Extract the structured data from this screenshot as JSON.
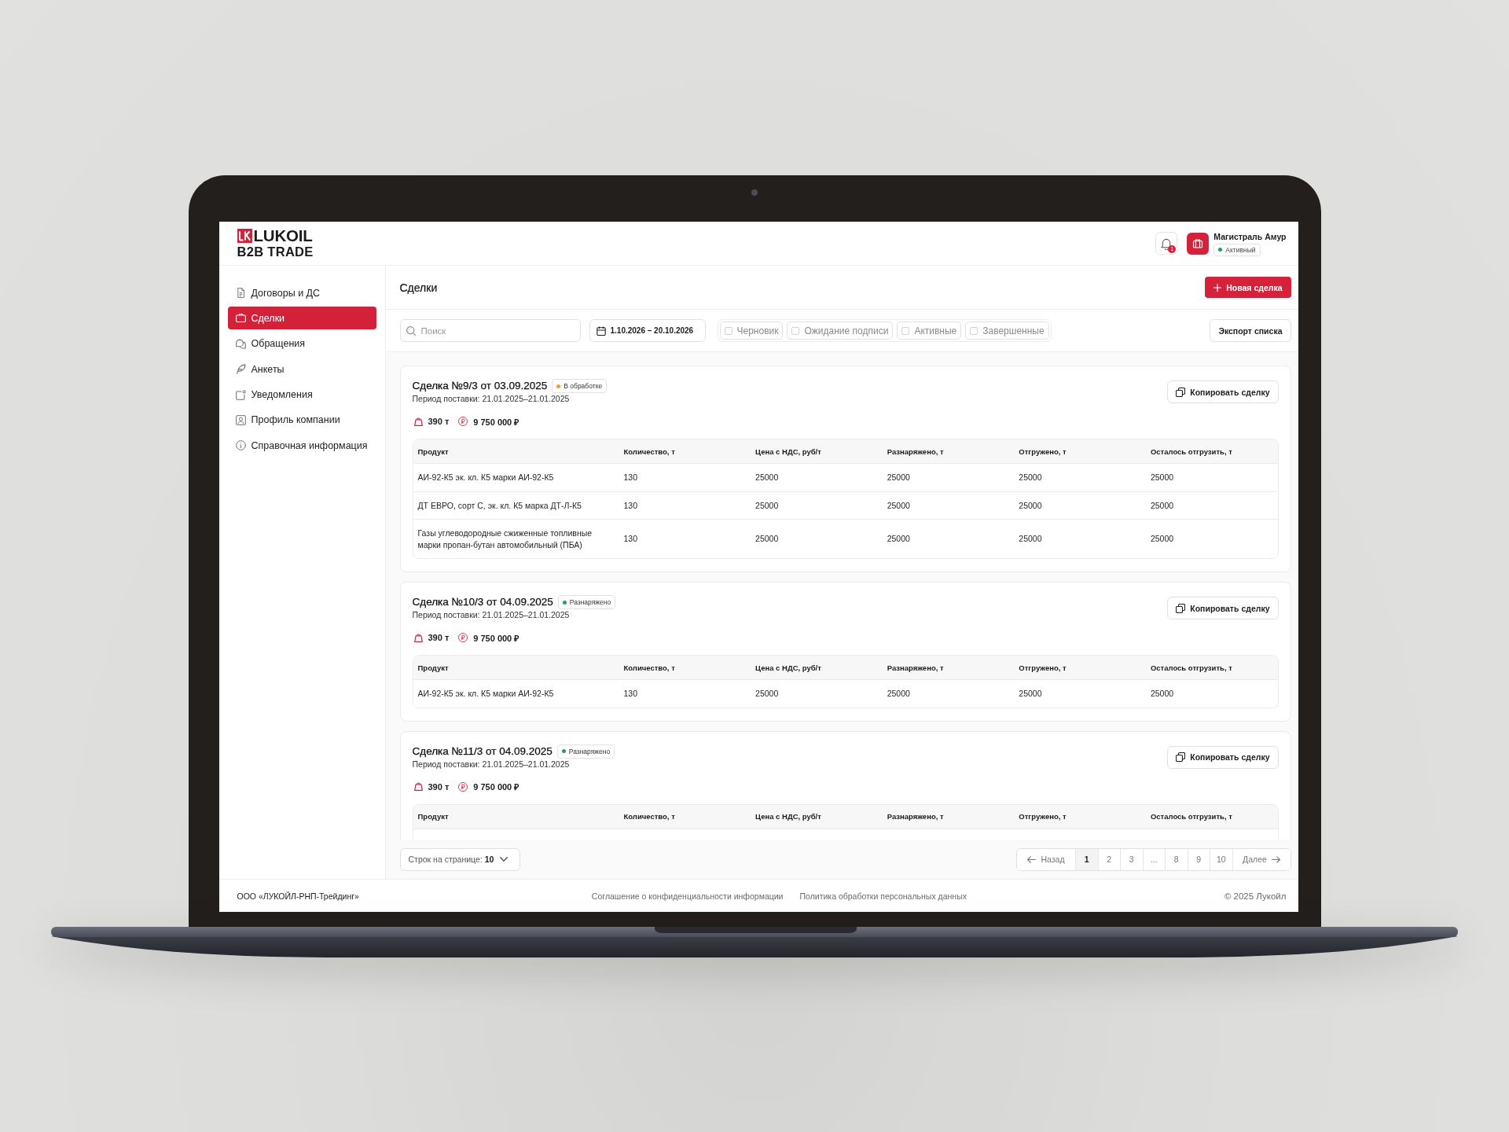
{
  "header": {
    "logo": {
      "wordmark": "LUKOIL",
      "tagline": "B2B TRADE"
    },
    "notifications": {
      "badge": "1"
    },
    "company": {
      "name": "Магистраль Амур",
      "status": "Активный"
    }
  },
  "sidebar": {
    "items": [
      {
        "label": "Договоры и ДС",
        "selected": false
      },
      {
        "label": "Сделки",
        "selected": true
      },
      {
        "label": "Обращения",
        "selected": false
      },
      {
        "label": "Анкеты",
        "selected": false
      },
      {
        "label": "Уведомления",
        "selected": false
      },
      {
        "label": "Профиль компании",
        "selected": false
      },
      {
        "label": "Справочная информация",
        "selected": false
      }
    ]
  },
  "page": {
    "title": "Сделки",
    "new_button": "Новая сделка"
  },
  "toolbar": {
    "search": {
      "placeholder": "Поиск"
    },
    "date_range": "1.10.2026 – 20.10.2026",
    "filters": [
      {
        "label": "Черновик",
        "checked": false
      },
      {
        "label": "Ожидание подписи",
        "checked": false
      },
      {
        "label": "Активные",
        "checked": false
      },
      {
        "label": "Завершенные",
        "checked": false
      }
    ],
    "export_button": "Экспорт списка"
  },
  "deals": [
    {
      "title": "Сделка №9/3 от 03.09.2025",
      "status": {
        "label": "В обработке",
        "color": "#f0a12b"
      },
      "period": "Период поставки: 21.01.2025–21.01.2025",
      "volume": "390 т",
      "amount": "9 750 000 ₽",
      "copy_button": "Копировать сделку",
      "table": {
        "columns": [
          "Продукт",
          "Количество, т",
          "Цена с НДС, руб/т",
          "Разнаряжено, т",
          "Отгружено, т",
          "Осталось отгрузить, т"
        ],
        "rows": [
          [
            "АИ-92-К5 эк. кл. К5 марки АИ-92-К5",
            "130",
            "25000",
            "25000",
            "25000",
            "25000"
          ],
          [
            "ДТ ЕВРО, сорт С, эк. кл. К5 марка ДТ-Л-К5",
            "130",
            "25000",
            "25000",
            "25000",
            "25000"
          ],
          [
            "Газы углеводородные сжиженные топливные марки пропан-бутан автомобильный (ПБА)",
            "130",
            "25000",
            "25000",
            "25000",
            "25000"
          ]
        ]
      }
    },
    {
      "title": "Сделка №10/3 от 04.09.2025",
      "status": {
        "label": "Разнаряжено",
        "color": "#1f9d62"
      },
      "period": "Период поставки: 21.01.2025–21.01.2025",
      "volume": "390 т",
      "amount": "9 750 000 ₽",
      "copy_button": "Копировать сделку",
      "table": {
        "columns": [
          "Продукт",
          "Количество, т",
          "Цена с НДС, руб/т",
          "Разнаряжено, т",
          "Отгружено, т",
          "Осталось отгрузить, т"
        ],
        "rows": [
          [
            "АИ-92-К5 эк. кл. К5 марки АИ-92-К5",
            "130",
            "25000",
            "25000",
            "25000",
            "25000"
          ]
        ]
      }
    },
    {
      "title": "Сделка №11/3 от 04.09.2025",
      "status": {
        "label": "Разнаряжено",
        "color": "#1f9d62"
      },
      "period": "Период поставки: 21.01.2025–21.01.2025",
      "volume": "390 т",
      "amount": "9 750 000 ₽",
      "copy_button": "Копировать сделку",
      "table": {
        "columns": [
          "Продукт",
          "Количество, т",
          "Цена с НДС, руб/т",
          "Разнаряжено, т",
          "Отгружено, т",
          "Осталось отгрузить, т"
        ]
      }
    }
  ],
  "pagination": {
    "rows_per_page": "Строк на странице: **10**",
    "prev": "Назад",
    "pages": [
      {
        "label": "1",
        "selected": true
      },
      {
        "label": "2",
        "selected": false
      },
      {
        "label": "3",
        "selected": false
      },
      {
        "label": "...",
        "selected": false
      },
      {
        "label": "8",
        "selected": false
      },
      {
        "label": "9",
        "selected": false
      },
      {
        "label": "10",
        "selected": false
      }
    ],
    "next": "Далее"
  },
  "footer": {
    "company": "ООО «ЛУКОЙЛ-РНП-Трейдинг»",
    "links": [
      "Соглашение о конфиденциальности информации",
      "Политика обработки персональных данных"
    ],
    "copyright": "© 2025 Лукойл"
  }
}
